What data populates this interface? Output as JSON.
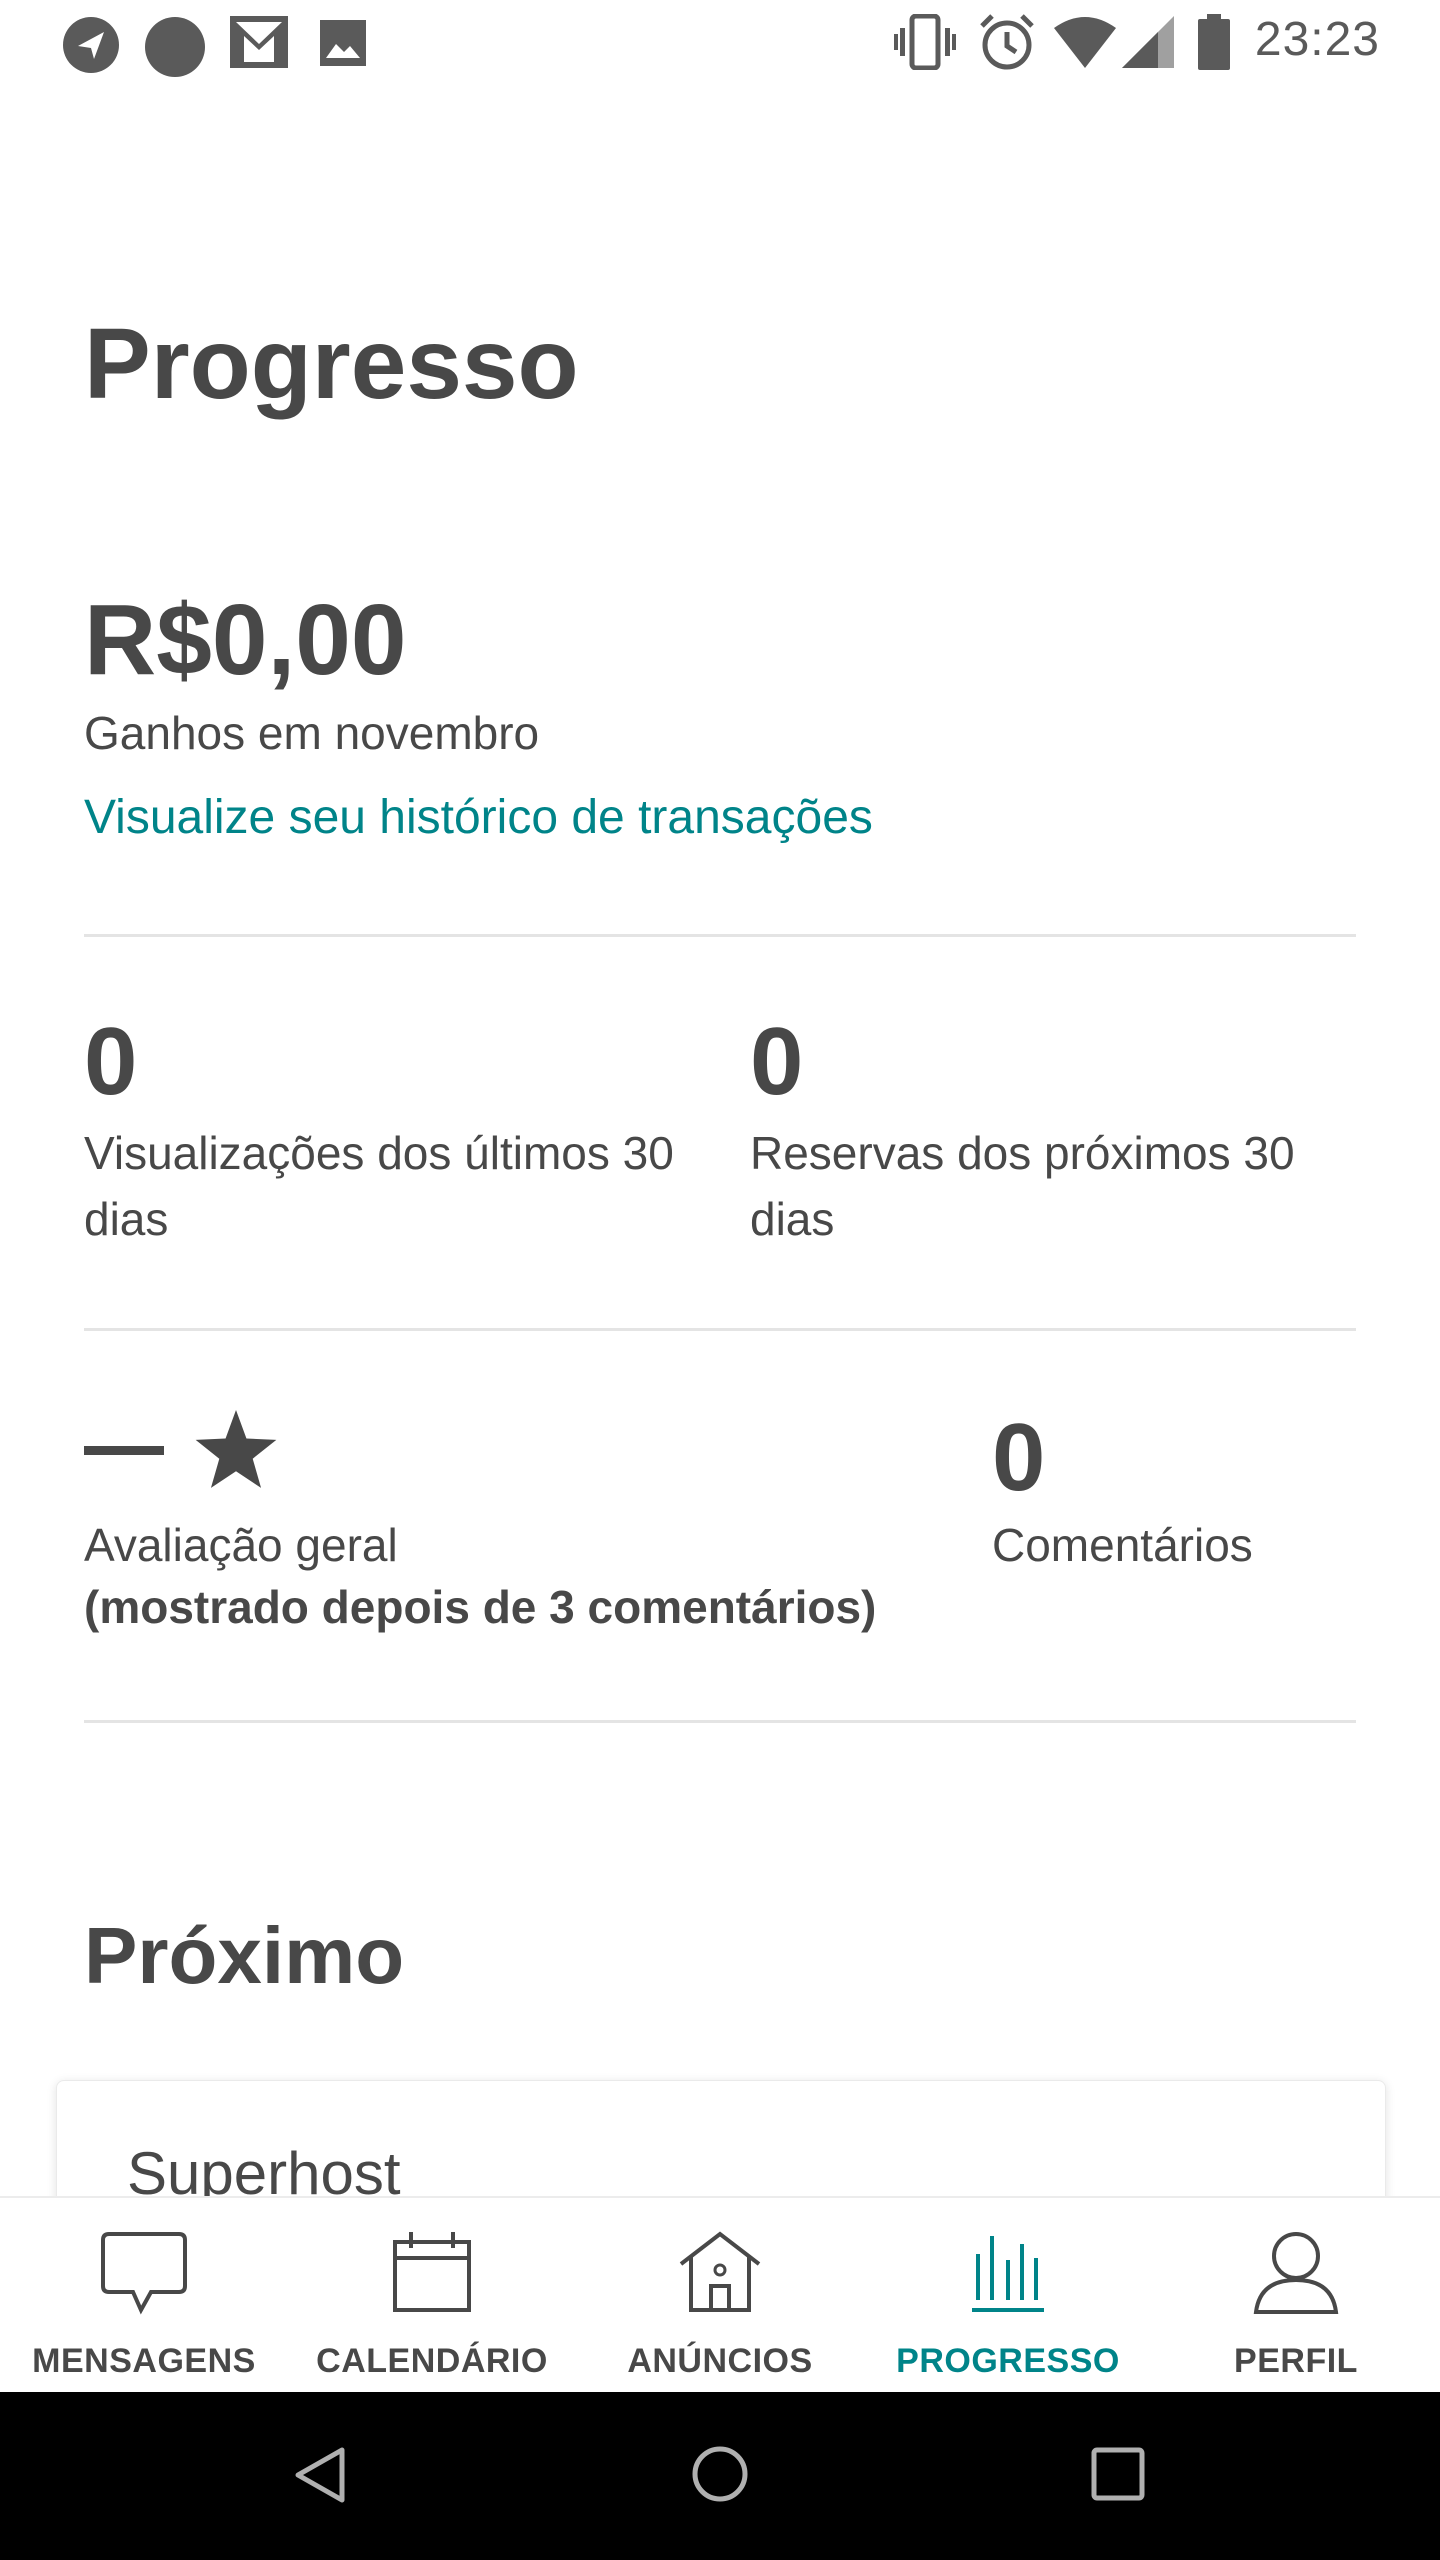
{
  "status_bar": {
    "time": "23:23",
    "icons": [
      "navigation-icon",
      "circle-icon",
      "gmail-icon",
      "image-icon",
      "vibrate-icon",
      "alarm-icon",
      "wifi-icon",
      "signal-icon",
      "battery-icon"
    ]
  },
  "page": {
    "title": "Progresso"
  },
  "earnings": {
    "amount": "R$0,00",
    "label": "Ganhos em novembro",
    "history_link": "Visualize seu histórico de transações"
  },
  "stats": {
    "views": {
      "value": "0",
      "label_line1": "Visualizações dos últimos 30",
      "label_line2": "dias"
    },
    "bookings": {
      "value": "0",
      "label_line1": "Reservas dos próximos 30",
      "label_line2": "dias"
    },
    "rating": {
      "label": "Avaliação geral",
      "note": "(mostrado depois de 3 comentários)"
    },
    "reviews": {
      "value": "0",
      "label": "Comentários"
    }
  },
  "next_section": {
    "title": "Próximo",
    "card_title": "Superhost"
  },
  "tabs": [
    {
      "label": "MENSAGENS",
      "icon": "chat-bubble-icon",
      "active": false
    },
    {
      "label": "CALENDÁRIO",
      "icon": "calendar-icon",
      "active": false
    },
    {
      "label": "ANÚNCIOS",
      "icon": "house-icon",
      "active": false
    },
    {
      "label": "PROGRESSO",
      "icon": "bar-chart-icon",
      "active": true
    },
    {
      "label": "PERFIL",
      "icon": "person-icon",
      "active": false
    }
  ],
  "colors": {
    "accent": "#008489",
    "text": "#484848",
    "divider": "#e4e4e4"
  }
}
